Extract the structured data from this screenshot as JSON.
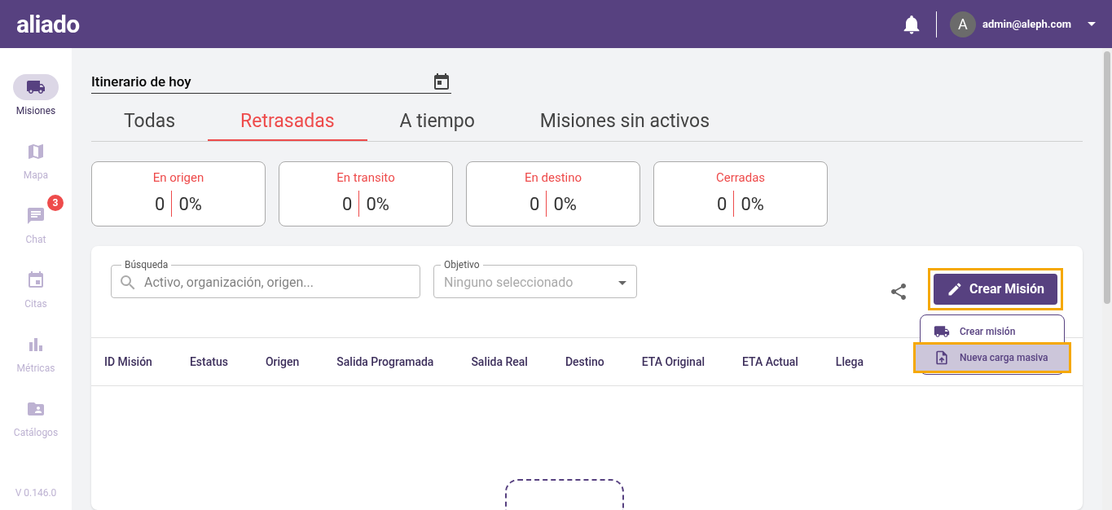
{
  "header": {
    "logo": "aliado",
    "user_initial": "A",
    "user_email": "admin@aleph.com"
  },
  "sidebar": {
    "items": [
      {
        "kind": "truck",
        "label": "Misiones",
        "selected": true
      },
      {
        "kind": "map",
        "label": "Mapa",
        "selected": false
      },
      {
        "kind": "chat",
        "label": "Chat",
        "selected": false,
        "badge": "3"
      },
      {
        "kind": "calendar",
        "label": "Citas",
        "selected": false
      },
      {
        "kind": "chart",
        "label": "Métricas",
        "selected": false
      },
      {
        "kind": "folder",
        "label": "Catálogos",
        "selected": false
      }
    ],
    "version": "V 0.146.0"
  },
  "date_field": {
    "value": "Itinerario de hoy"
  },
  "tabs": [
    {
      "label": "Todas",
      "selected": false
    },
    {
      "label": "Retrasadas",
      "selected": true
    },
    {
      "label": "A tiempo",
      "selected": false
    },
    {
      "label": "Misiones sin activos",
      "selected": false
    }
  ],
  "stat_cards": [
    {
      "title": "En origen",
      "count": "0",
      "percent": "0%"
    },
    {
      "title": "En transito",
      "count": "0",
      "percent": "0%"
    },
    {
      "title": "En destino",
      "count": "0",
      "percent": "0%"
    },
    {
      "title": "Cerradas",
      "count": "0",
      "percent": "0%"
    }
  ],
  "search": {
    "label": "Búsqueda",
    "placeholder": "Activo, organización, origen..."
  },
  "objective": {
    "label": "Objetivo",
    "value": "Ninguno seleccionado"
  },
  "create_button": {
    "label": "Crear Misión",
    "highlighted": true
  },
  "create_menu": [
    {
      "kind": "truck",
      "label": "Crear misión",
      "highlighted": false
    },
    {
      "kind": "upload",
      "label": "Nueva carga masiva",
      "highlighted": true
    }
  ],
  "table": {
    "columns": [
      "ID Misión",
      "Estatus",
      "Origen",
      "Salida Programada",
      "Salida Real",
      "Destino",
      "ETA Original",
      "ETA Actual",
      "Llega"
    ]
  }
}
